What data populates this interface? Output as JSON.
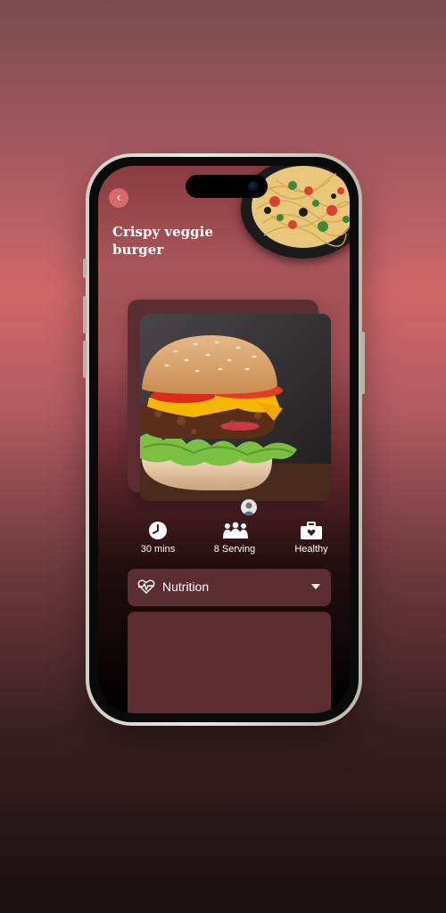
{
  "recipe": {
    "title": "Crispy veggie burger",
    "back_icon": "chevron-left-icon"
  },
  "stats": [
    {
      "icon": "clock-icon",
      "label": "30 mins"
    },
    {
      "icon": "people-icon",
      "label": "8 Serving"
    },
    {
      "icon": "briefcase-heart-icon",
      "label": "Healthy"
    }
  ],
  "nutrition": {
    "label": "Nutrition",
    "icon": "heartbeat-icon",
    "caret": "caret-down-icon"
  },
  "colors": {
    "accent": "#d9696c",
    "panel": "#5b2d33",
    "text": "#ffffff"
  }
}
